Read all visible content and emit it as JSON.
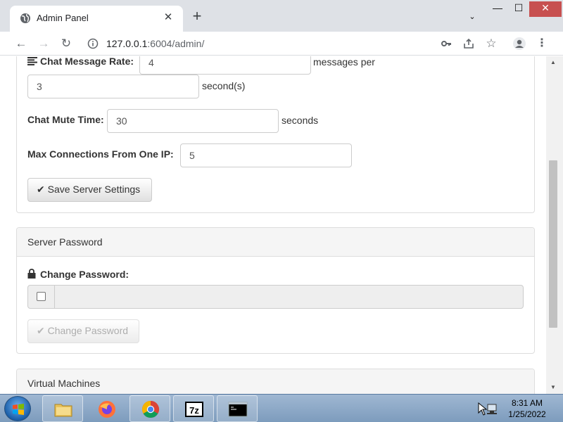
{
  "browser": {
    "tab_title": "Admin Panel",
    "tab_close_glyph": "✕",
    "new_tab_glyph": "+",
    "url_host": "127.0.0.1",
    "url_rest": ":6004/admin/",
    "window_controls": {
      "chevron": "⌄",
      "minimize": "—",
      "maximize": "☐",
      "close": "✕"
    }
  },
  "server_settings": {
    "chat_rate_label": "Chat Message Rate:",
    "chat_rate_messages": "4",
    "messages_per_text": "messages per",
    "chat_rate_seconds": "3",
    "seconds_suffix": "second(s)",
    "mute_time_label": "Chat Mute Time:",
    "mute_time_value": "30",
    "mute_time_suffix": "seconds",
    "max_conn_label": "Max Connections From One IP:",
    "max_conn_value": "5",
    "save_button": "Save Server Settings"
  },
  "server_password": {
    "heading": "Server Password",
    "change_label": "Change Password:",
    "checkbox_checked": false,
    "button": "Change Password",
    "button_disabled": true
  },
  "virtual_machines": {
    "heading": "Virtual Machines"
  },
  "taskbar": {
    "apps": [
      "file-explorer",
      "firefox",
      "chrome",
      "7-zip",
      "command-prompt"
    ],
    "clock_time": "8:31 AM",
    "clock_date": "1/25/2022"
  },
  "colors": {
    "panel_heading_bg": "#f5f5f5",
    "panel_border": "#dddddd",
    "taskbar_blue": "#8eaacb",
    "close_red": "#c75050"
  }
}
